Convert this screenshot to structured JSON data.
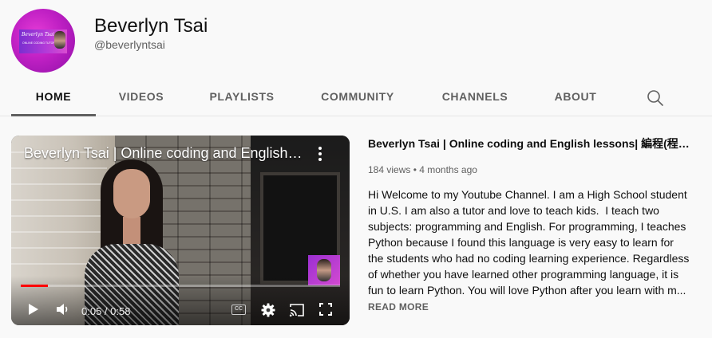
{
  "channel": {
    "name": "Beverlyn Tsai",
    "handle": "@beverlyntsai",
    "avatar_text": "Beverlyn Tsai",
    "avatar_subtext": "ONLINE CODING TUTORIALS"
  },
  "tabs": [
    {
      "label": "HOME",
      "active": true
    },
    {
      "label": "VIDEOS",
      "active": false
    },
    {
      "label": "PLAYLISTS",
      "active": false
    },
    {
      "label": "COMMUNITY",
      "active": false
    },
    {
      "label": "CHANNELS",
      "active": false
    },
    {
      "label": "ABOUT",
      "active": false
    }
  ],
  "search_icon": "search-icon",
  "player": {
    "title": "Beverlyn Tsai | Online coding and English l...",
    "time_display": "0:05 / 0:58",
    "progress_fraction": 0.086,
    "cc_label": "CC",
    "icons": [
      "play-icon",
      "volume-icon",
      "cc-icon",
      "gear-icon",
      "cast-icon",
      "fullscreen-icon",
      "kebab-icon"
    ]
  },
  "video_info": {
    "title": "Beverlyn Tsai | Online coding and English lessons| 編程(程式語...",
    "meta": "184 views • 4 months ago",
    "description": "Hi Welcome to my Youtube Channel. I am a High School student in U.S. I am also a tutor and love to teach kids.  I teach two subjects: programming and English. For programming, I teaches Python because I found this language is very easy to learn for the students who had no coding learning experience. Regardless of whether you have learned other programming language, it is fun to learn Python. You will love Python after you learn with m...",
    "read_more": "READ MORE"
  },
  "colors": {
    "accent_red": "#ff0000",
    "avatar_magenta": "#c020c4",
    "text_secondary": "#606060"
  }
}
